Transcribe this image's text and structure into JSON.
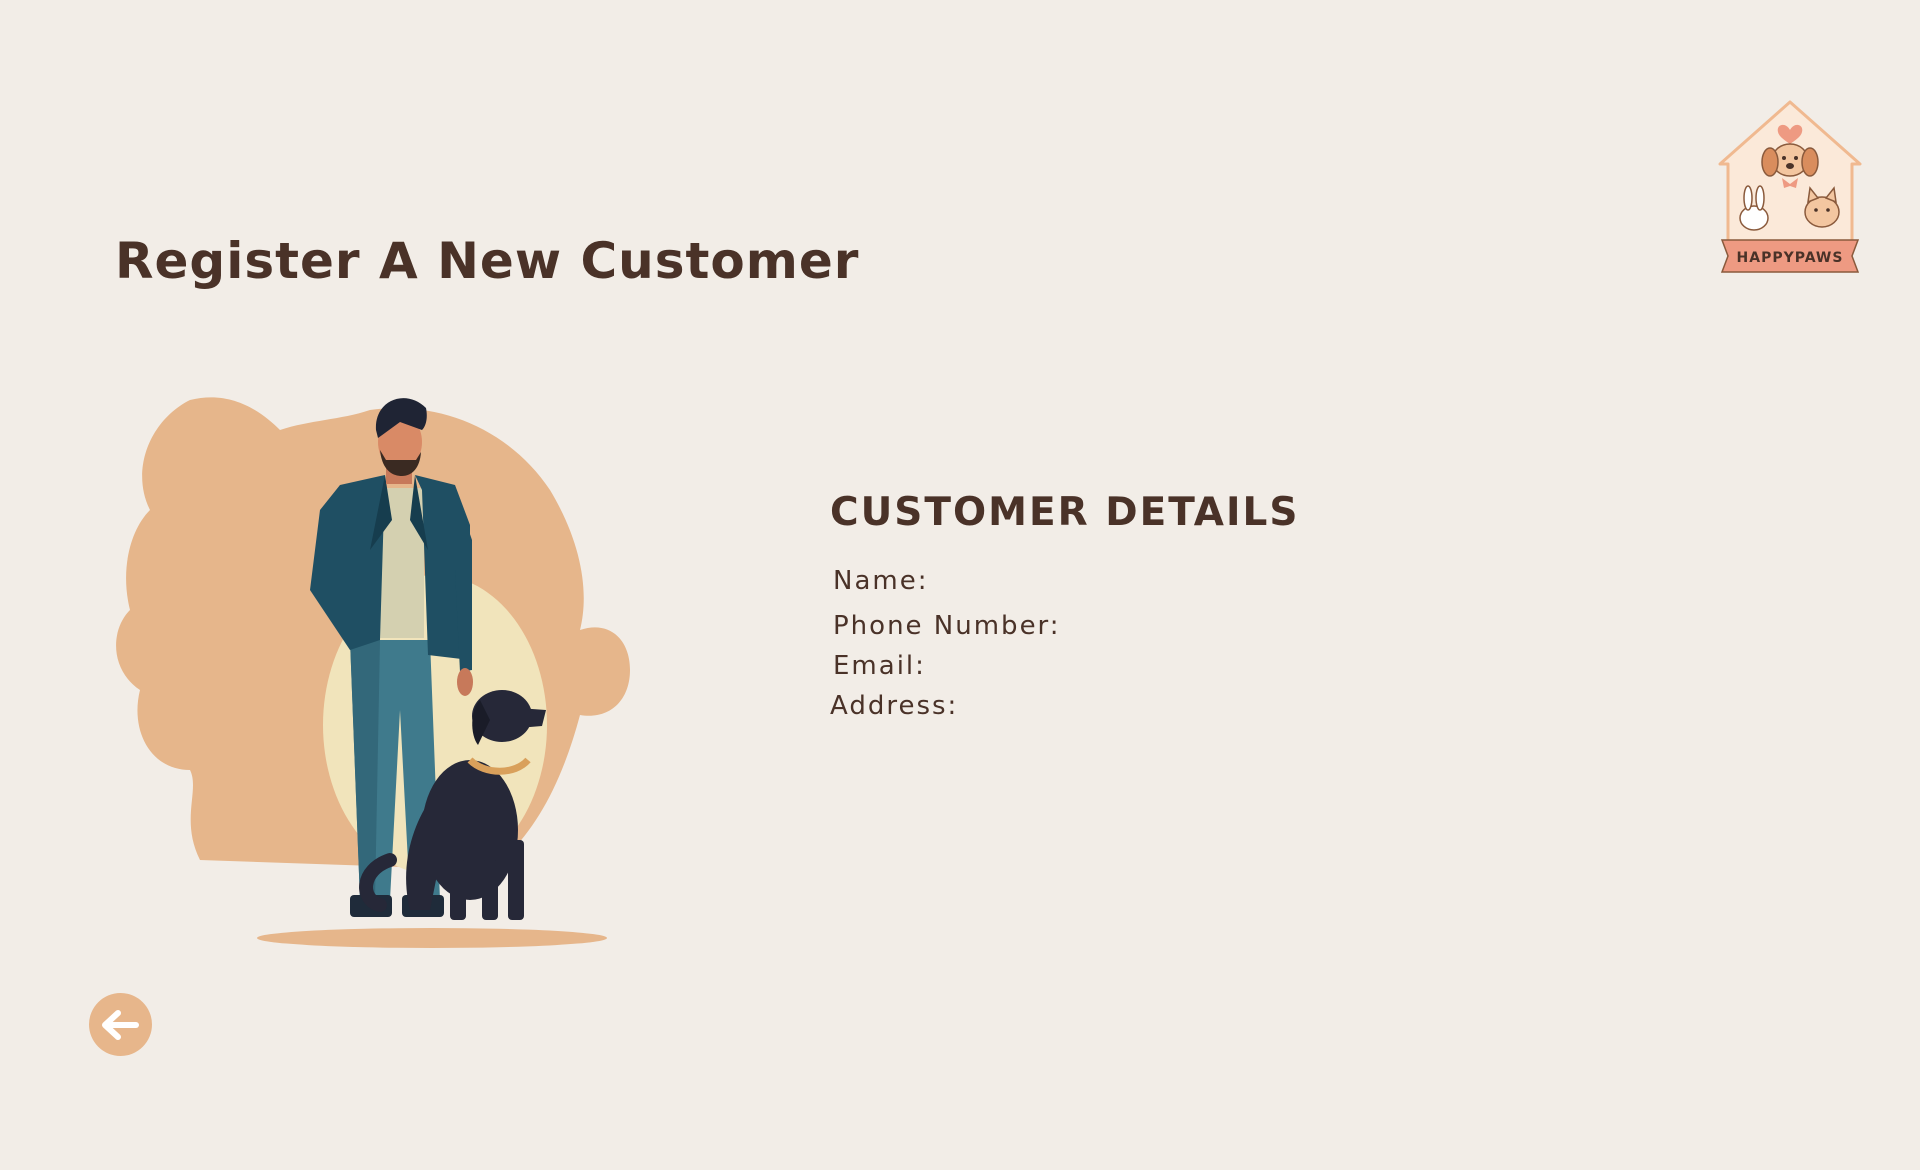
{
  "header": {
    "title": "Register A New Customer"
  },
  "logo": {
    "text": "HAPPYPAWS",
    "icon": "pet-house-logo"
  },
  "illustration": {
    "icon": "man-with-dog-illustration"
  },
  "customer_details": {
    "title": "CUSTOMER DETAILS",
    "fields": {
      "name": "Name:",
      "phone": "Phone Number:",
      "email": "Email:",
      "address": "Address:"
    }
  },
  "navigation": {
    "back_icon": "arrow-left-icon"
  },
  "colors": {
    "background": "#f2ede7",
    "text": "#4a3228",
    "accent": "#e7b68b"
  }
}
